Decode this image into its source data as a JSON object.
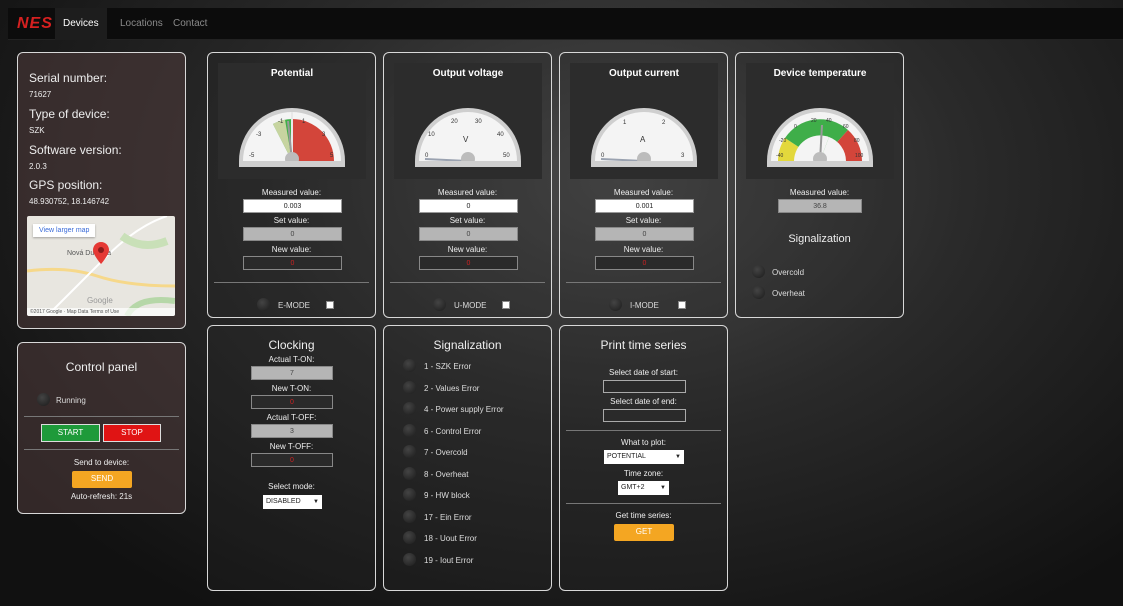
{
  "app": {
    "brand": "NES",
    "tabs": [
      {
        "label": "Devices"
      },
      {
        "label": "Locations"
      },
      {
        "label": "Contact"
      }
    ]
  },
  "info": {
    "serial_label": "Serial number:",
    "serial_value": "71627",
    "type_label": "Type of device:",
    "type_value": "SZK",
    "sw_label": "Software version:",
    "sw_value": "2.0.3",
    "gps_label": "GPS position:",
    "gps_value": "48.930752, 18.146742",
    "map": {
      "button": "View larger map",
      "town": "Nová Dubnica",
      "brand": "Google",
      "footer": "©2017 Google · Map Data    Terms of Use"
    }
  },
  "control": {
    "title": "Control panel",
    "status": "Running",
    "start": "START",
    "stop": "STOP",
    "send_label": "Send to device:",
    "send": "SEND",
    "autorefresh": "Auto-refresh: 21s"
  },
  "gauges": [
    {
      "title": "Potential",
      "measured": "0.003",
      "set": "0",
      "new": "0",
      "mode": "E-MODE"
    },
    {
      "title": "Output voltage",
      "measured": "0",
      "set": "0",
      "new": "0",
      "mode": "U-MODE"
    },
    {
      "title": "Output current",
      "measured": "0.001",
      "set": "0",
      "new": "0",
      "mode": "I-MODE"
    },
    {
      "title": "Device temperature",
      "measured": "36.8"
    }
  ],
  "labels": {
    "measured": "Measured value:",
    "set": "Set value:",
    "new": "New value:"
  },
  "temp_signalization": {
    "title": "Signalization",
    "items": [
      "Overcold",
      "Overheat"
    ]
  },
  "clocking": {
    "title": "Clocking",
    "actual_ton_label": "Actual T-ON:",
    "actual_ton": "7",
    "new_ton_label": "New T-ON:",
    "new_ton": "0",
    "actual_toff_label": "Actual T-OFF:",
    "actual_toff": "3",
    "new_toff_label": "New T-OFF:",
    "new_toff": "0",
    "mode_label": "Select mode:",
    "mode_value": "DISABLED"
  },
  "signalization": {
    "title": "Signalization",
    "items": [
      "1 - SZK Error",
      "2 - Values Error",
      "4 - Power supply Error",
      "6 - Control Error",
      "7 - Overcold",
      "8 - Overheat",
      "9 - HW block",
      "17 - Ein Error",
      "18 - Uout Error",
      "19 - Iout Error"
    ]
  },
  "timeseries": {
    "title": "Print time series",
    "start_label": "Select date of start:",
    "end_label": "Select date of end:",
    "plot_label": "What to plot:",
    "plot_value": "POTENTIAL",
    "tz_label": "Time zone:",
    "tz_value": "GMT+2",
    "get_label": "Get time series:",
    "get": "GET"
  },
  "gauge_scales": {
    "potential": [
      "-5",
      "-3",
      "-1",
      "1",
      "3",
      "5"
    ],
    "voltage": [
      "0",
      "10",
      "20",
      "30",
      "40",
      "50"
    ],
    "voltage_unit": "V",
    "current": [
      "0",
      "1",
      "2",
      "3"
    ],
    "current_unit": "A",
    "temperature": [
      "-40",
      "-20",
      "0",
      "20",
      "40",
      "60",
      "80",
      "100"
    ]
  },
  "colors": {
    "brand": "#d62020",
    "start": "#1e9a3a",
    "stop": "#e01414",
    "orange": "#f4a622",
    "gauge_red": "#d3453a",
    "gauge_green": "#3fae49",
    "gauge_yellow": "#e3d83c"
  }
}
